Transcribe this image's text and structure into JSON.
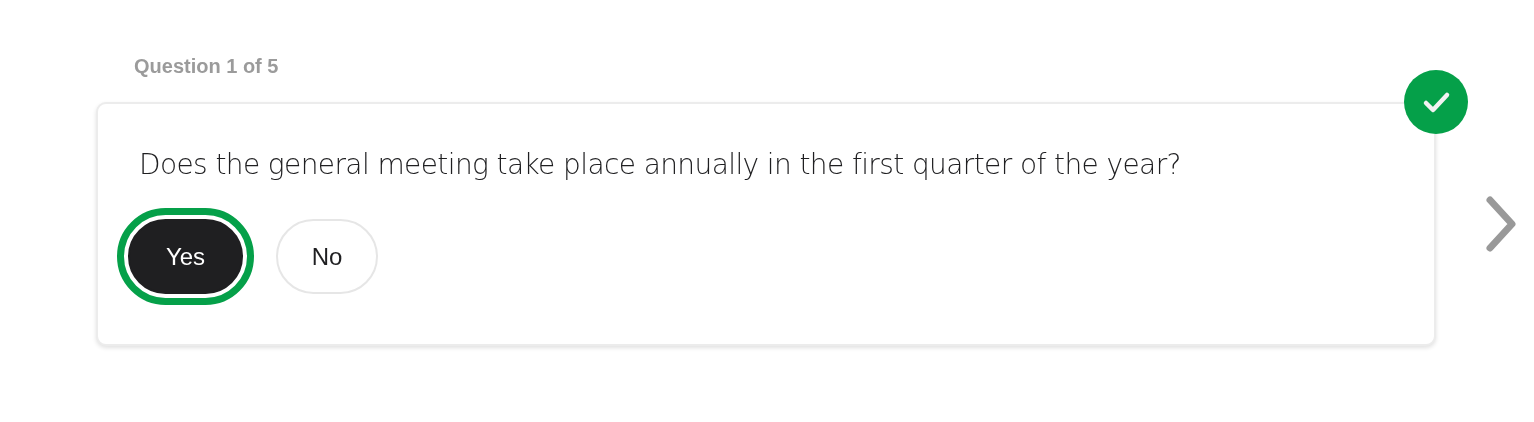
{
  "progress": "Question 1 of 5",
  "question": {
    "text": "Does the general meeting take place annually in the first quarter of the year?",
    "answered": true,
    "options": [
      {
        "label": "Yes",
        "selected": true
      },
      {
        "label": "No",
        "selected": false
      }
    ]
  },
  "next_enabled": true
}
